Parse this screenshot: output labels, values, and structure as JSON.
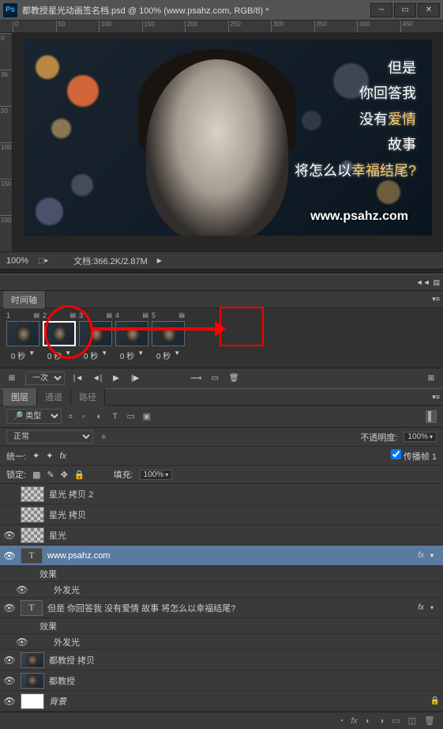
{
  "titlebar": {
    "title": "都教授星光动画签名档.psd @ 100% (www.psahz.com, RGB/8) *"
  },
  "ruler": {
    "top": [
      "0",
      "50",
      "100",
      "150",
      "200",
      "250",
      "300",
      "350",
      "400",
      "450"
    ],
    "left": [
      "0",
      "36",
      "50",
      "100",
      "150",
      "200"
    ]
  },
  "canvas": {
    "text_lines": [
      "但是",
      "你回答我",
      "没有爱情",
      "故事",
      "将怎么以幸福结尾?"
    ],
    "watermark": "www.psahz.com"
  },
  "status": {
    "zoom": "100%",
    "doc_label": "文档:",
    "doc_info": "366.2K/2.87M"
  },
  "timeline": {
    "tab": "时间轴",
    "frames": [
      {
        "num": "1",
        "delay": "0 秒"
      },
      {
        "num": "2",
        "delay": "0 秒"
      },
      {
        "num": "3",
        "delay": "0 秒"
      },
      {
        "num": "4",
        "delay": "0 秒"
      },
      {
        "num": "5",
        "delay": "0 秒"
      }
    ],
    "loop": "一次"
  },
  "layers_panel": {
    "tabs": {
      "layers": "图层",
      "channels": "通道",
      "paths": "路径"
    },
    "filter": "类型",
    "blend_mode": "正常",
    "opacity_label": "不透明度:",
    "opacity": "100%",
    "unify_label": "统一:",
    "propagate": "传播帧 1",
    "lock_label": "锁定:",
    "fill_label": "填充:",
    "fill": "100%",
    "layers": [
      {
        "vis": false,
        "thumb": "checker",
        "name": "星光 拷贝 2"
      },
      {
        "vis": false,
        "thumb": "checker",
        "name": "星光 拷贝"
      },
      {
        "vis": true,
        "thumb": "checker",
        "name": "星光"
      },
      {
        "vis": true,
        "type": "T",
        "name": "www.psahz.com",
        "fx": true,
        "selected": true
      },
      {
        "sub": true,
        "name": "效果"
      },
      {
        "sub2": true,
        "vis": true,
        "name": "外发光"
      },
      {
        "vis": true,
        "type": "T",
        "name": "但是 你回答我 没有爱情 故事 将怎么以幸福结尾?",
        "fx": true
      },
      {
        "sub": true,
        "name": "效果"
      },
      {
        "sub2": true,
        "vis": true,
        "name": "外发光"
      },
      {
        "vis": true,
        "thumb": "dark",
        "name": "都教授 拷贝"
      },
      {
        "vis": true,
        "thumb": "dark",
        "name": "都教授"
      },
      {
        "vis": true,
        "thumb": "white",
        "name": "背景",
        "locked": true,
        "italic": true
      }
    ]
  }
}
